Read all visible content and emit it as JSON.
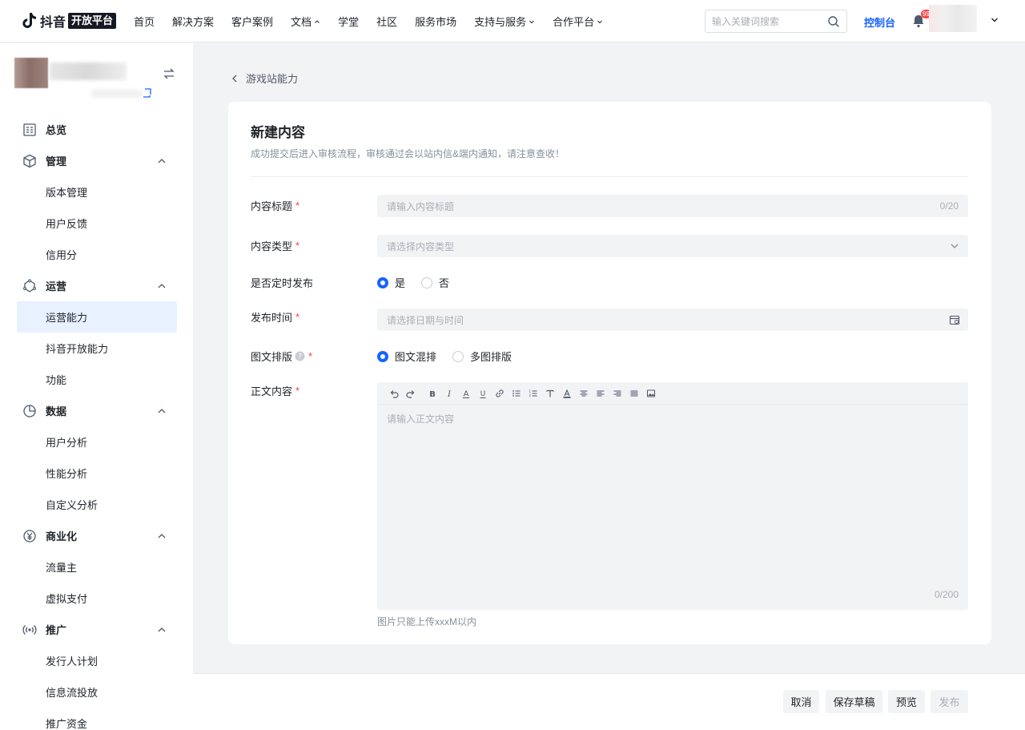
{
  "topnav": {
    "logo_text": "抖音",
    "logo_badge": "开放平台",
    "items": [
      {
        "label": "首页",
        "caret": false
      },
      {
        "label": "解决方案",
        "caret": false
      },
      {
        "label": "客户案例",
        "caret": false
      },
      {
        "label": "文档",
        "caret": true
      },
      {
        "label": "学堂",
        "caret": false
      },
      {
        "label": "社区",
        "caret": false
      },
      {
        "label": "服务市场",
        "caret": false
      },
      {
        "label": "支持与服务",
        "caret": true
      },
      {
        "label": "合作平台",
        "caret": true
      }
    ],
    "search_placeholder": "输入关键词搜索",
    "console_label": "控制台",
    "notification_badge": "99"
  },
  "sidebar": {
    "groups": [
      {
        "label": "总览",
        "icon": "dashboard-icon",
        "children": []
      },
      {
        "label": "管理",
        "icon": "box-icon",
        "children": [
          "版本管理",
          "用户反馈",
          "信用分"
        ]
      },
      {
        "label": "运营",
        "icon": "operation-icon",
        "children": [
          "运营能力",
          "抖音开放能力",
          "功能"
        ]
      },
      {
        "label": "数据",
        "icon": "pie-chart-icon",
        "children": [
          "用户分析",
          "性能分析",
          "自定义分析"
        ]
      },
      {
        "label": "商业化",
        "icon": "yen-icon",
        "children": [
          "流量主",
          "虚拟支付"
        ]
      },
      {
        "label": "推广",
        "icon": "broadcast-icon",
        "children": [
          "发行人计划",
          "信息流投放",
          "推广资金"
        ]
      }
    ],
    "active_item": "运营能力"
  },
  "breadcrumb": {
    "back_label": "游戏站能力"
  },
  "form": {
    "title": "新建内容",
    "description": "成功提交后进入审核流程，审核通过会以站内信&端内通知，请注意查收！",
    "fields": {
      "content_title": {
        "label": "内容标题",
        "placeholder": "请输入内容标题",
        "counter": "0/20"
      },
      "content_type": {
        "label": "内容类型",
        "placeholder": "请选择内容类型"
      },
      "scheduled": {
        "label": "是否定时发布",
        "options": [
          "是",
          "否"
        ],
        "selected": "是"
      },
      "publish_time": {
        "label": "发布时间",
        "placeholder": "请选择日期与时间"
      },
      "layout": {
        "label": "图文排版",
        "options": [
          "图文混排",
          "多图排版"
        ],
        "selected": "图文混排"
      },
      "body": {
        "label": "正文内容",
        "placeholder": "请输入正文内容",
        "counter": "0/200",
        "hint": "图片只能上传xxxM以内"
      }
    },
    "required_mark": "*"
  },
  "editor_toolbar": [
    "undo-icon",
    "redo-icon",
    "bold-icon",
    "italic-icon",
    "font-color-icon",
    "underline-icon",
    "link-icon",
    "bullet-list-icon",
    "numbered-list-icon",
    "text-style-icon",
    "highlight-icon",
    "align-center-icon",
    "align-left-icon",
    "align-right-icon",
    "align-justify-icon",
    "image-icon"
  ],
  "footer": {
    "cancel": "取消",
    "save_draft": "保存草稿",
    "preview": "预览",
    "publish": "发布"
  },
  "colors": {
    "accent": "#1664ff",
    "required": "#f53f3f",
    "active_bg": "#e8f1ff"
  }
}
